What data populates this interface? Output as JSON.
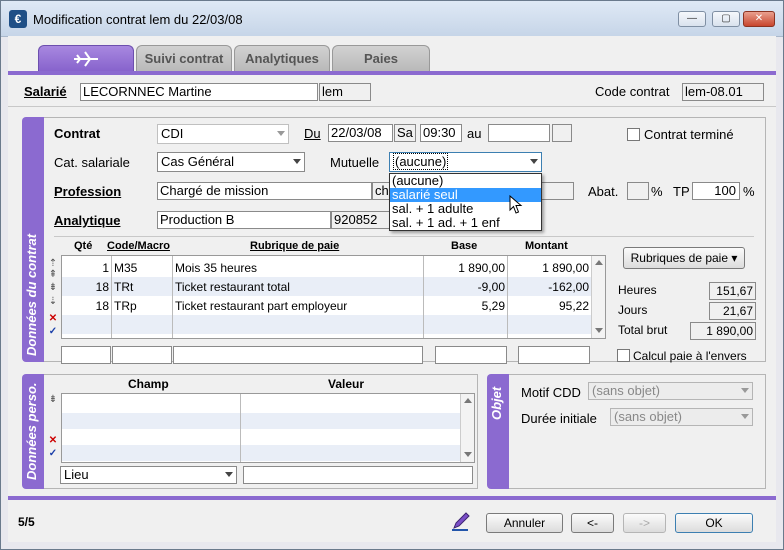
{
  "window": {
    "title": "Modification contrat lem du 22/03/08",
    "app_icon": "€"
  },
  "tabs": [
    {
      "label": ""
    },
    {
      "label": "Suivi contrat"
    },
    {
      "label": "Analytiques"
    },
    {
      "label": "Paies"
    }
  ],
  "header": {
    "salarie_label": "Salarié",
    "salarie_name": "LECORNNEC Martine",
    "salarie_code": "lem",
    "code_contrat_label": "Code contrat",
    "code_contrat_value": "lem-08.01"
  },
  "contrat_panel": {
    "side_title": "Données du contrat",
    "contrat_label": "Contrat",
    "contrat_value": "CDI",
    "du_label": "Du",
    "du_date": "22/03/08",
    "du_day": "Sa",
    "du_time": "09:30",
    "au_label": "au",
    "contrat_termine_label": "Contrat terminé",
    "cat_label": "Cat. salariale",
    "cat_value": "Cas Général",
    "mutuelle_label": "Mutuelle",
    "mutuelle_value": "(aucune)",
    "mutuelle_options": [
      "(aucune)",
      "salarié seul",
      "sal. + 1 adulte",
      "sal. + 1 ad. + 1 enf"
    ],
    "profession_label": "Profession",
    "profession_value": "Chargé de mission",
    "profession_code": "chi",
    "abat_label": "Abat.",
    "pct": "%",
    "tp_label": "TP",
    "tp_value": "100",
    "analytique_label": "Analytique",
    "analytique_value": "Production B",
    "analytique_code": "920852"
  },
  "pay_grid": {
    "headers": [
      "Qté",
      "Code/Macro",
      "Rubrique de paie",
      "Base",
      "Montant"
    ],
    "rows": [
      {
        "qte": "1",
        "code": "M35",
        "rubrique": "Mois 35 heures",
        "base": "1 890,00",
        "montant": "1 890,00"
      },
      {
        "qte": "18",
        "code": "TRt",
        "rubrique": "Ticket restaurant total",
        "base": "-9,00",
        "montant": "-162,00"
      },
      {
        "qte": "18",
        "code": "TRp",
        "rubrique": "Ticket restaurant part employeur",
        "base": "5,29",
        "montant": "95,22"
      }
    ],
    "rubriques_button": "Rubriques de paie",
    "heures_label": "Heures",
    "heures_value": "151,67",
    "jours_label": "Jours",
    "jours_value": "21,67",
    "total_label": "Total brut",
    "total_value": "1 890,00",
    "calcul_label": "Calcul paie à l'envers"
  },
  "perso_panel": {
    "side_title": "Données perso.",
    "champ_header": "Champ",
    "valeur_header": "Valeur",
    "lieu_value": "Lieu"
  },
  "objet_panel": {
    "side_title": "Objet",
    "motif_label": "Motif CDD",
    "motif_value": "(sans objet)",
    "duree_label": "Durée initiale",
    "duree_value": "(sans objet)"
  },
  "footer": {
    "counter": "5/5",
    "annuler": "Annuler",
    "prev": "<-",
    "next": "->",
    "ok": "OK"
  },
  "colors": {
    "accent": "#8b6ad0",
    "selection": "#3399ff"
  }
}
